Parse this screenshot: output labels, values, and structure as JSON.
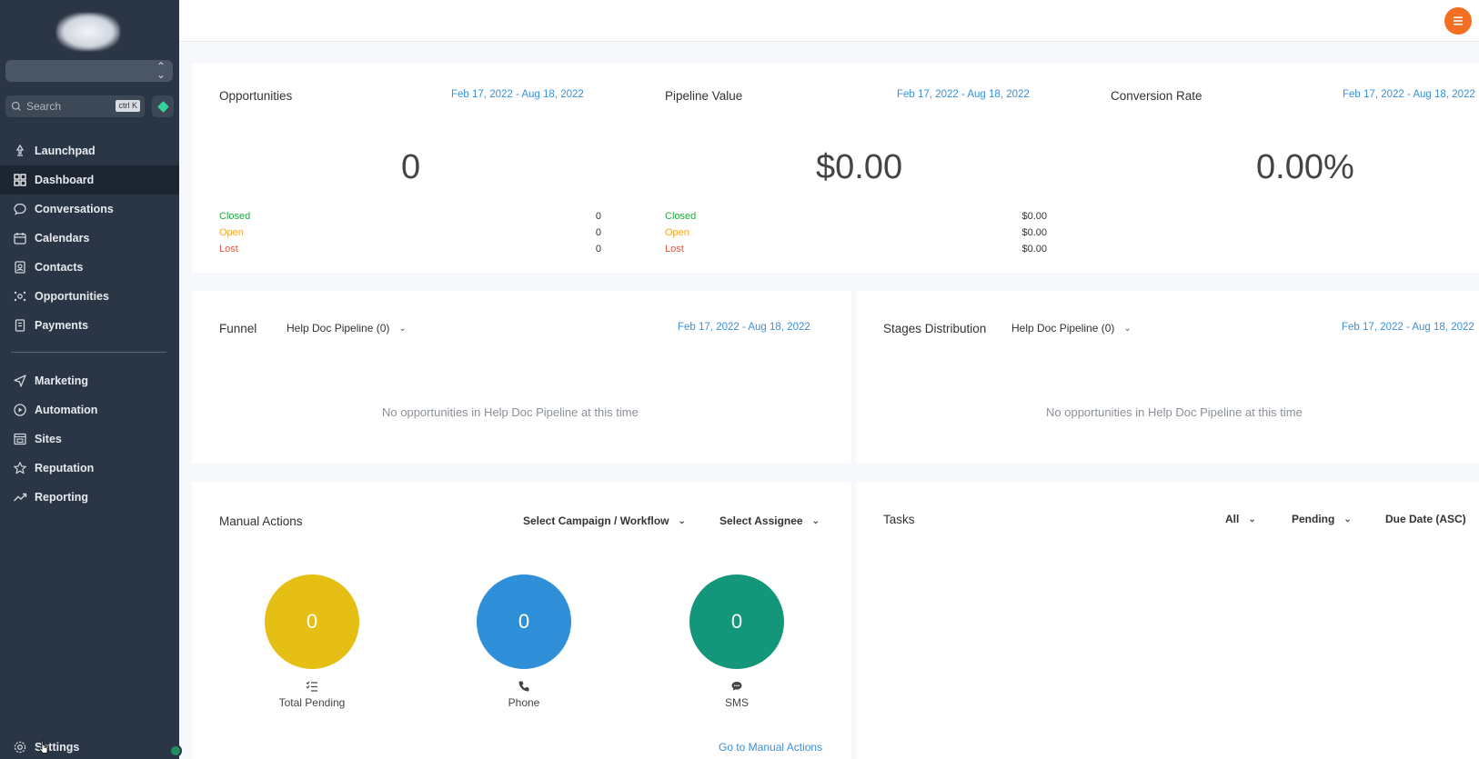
{
  "sidebar": {
    "search_placeholder": "Search",
    "search_shortcut": "ctrl K",
    "items": [
      {
        "label": "Launchpad",
        "icon": "launchpad-icon"
      },
      {
        "label": "Dashboard",
        "icon": "dashboard-icon",
        "active": true
      },
      {
        "label": "Conversations",
        "icon": "chat-icon"
      },
      {
        "label": "Calendars",
        "icon": "calendar-icon"
      },
      {
        "label": "Contacts",
        "icon": "contacts-icon"
      },
      {
        "label": "Opportunities",
        "icon": "opportunities-icon"
      },
      {
        "label": "Payments",
        "icon": "payments-icon"
      }
    ],
    "items2": [
      {
        "label": "Marketing",
        "icon": "send-icon"
      },
      {
        "label": "Automation",
        "icon": "automation-icon"
      },
      {
        "label": "Sites",
        "icon": "sites-icon"
      },
      {
        "label": "Reputation",
        "icon": "star-icon"
      },
      {
        "label": "Reporting",
        "icon": "trend-icon"
      }
    ],
    "settings_label": "Settings"
  },
  "opportunities": {
    "title": "Opportunities",
    "date_range": "Feb 17, 2022 - Aug 18, 2022",
    "value": "0",
    "closed_label": "Closed",
    "closed_value": "0",
    "open_label": "Open",
    "open_value": "0",
    "lost_label": "Lost",
    "lost_value": "0"
  },
  "pipeline_value": {
    "title": "Pipeline Value",
    "date_range": "Feb 17, 2022 - Aug 18, 2022",
    "value": "$0.00",
    "closed_label": "Closed",
    "closed_value": "$0.00",
    "open_label": "Open",
    "open_value": "$0.00",
    "lost_label": "Lost",
    "lost_value": "$0.00"
  },
  "conversion_rate": {
    "title": "Conversion Rate",
    "date_range": "Feb 17, 2022 - Aug 18, 2022",
    "value": "0.00%"
  },
  "funnel": {
    "title": "Funnel",
    "pipeline": "Help Doc Pipeline (0)",
    "date_range": "Feb 17, 2022 - Aug 18, 2022",
    "empty": "No opportunities in Help Doc Pipeline at this time"
  },
  "stages": {
    "title": "Stages Distribution",
    "pipeline": "Help Doc Pipeline (0)",
    "date_range": "Feb 17, 2022 - Aug 18, 2022",
    "empty": "No opportunities in Help Doc Pipeline at this time"
  },
  "manual_actions": {
    "title": "Manual Actions",
    "campaign_select": "Select Campaign / Workflow",
    "assignee_select": "Select Assignee",
    "total_pending": {
      "value": "0",
      "label": "Total Pending",
      "color": "#e5bf14"
    },
    "phone": {
      "value": "0",
      "label": "Phone",
      "color": "#2f8fd8"
    },
    "sms": {
      "value": "0",
      "label": "SMS",
      "color": "#13967a"
    },
    "go_link": "Go to Manual Actions"
  },
  "tasks": {
    "title": "Tasks",
    "filter_all": "All",
    "filter_status": "Pending",
    "sort": "Due Date (ASC)"
  },
  "colors": {
    "sidebar": "#2a3545",
    "accent": "#3b8fd6",
    "closed": "#22a93f",
    "open": "#f5a623",
    "lost": "#e5533d",
    "topbar_button": "#f36f21"
  }
}
